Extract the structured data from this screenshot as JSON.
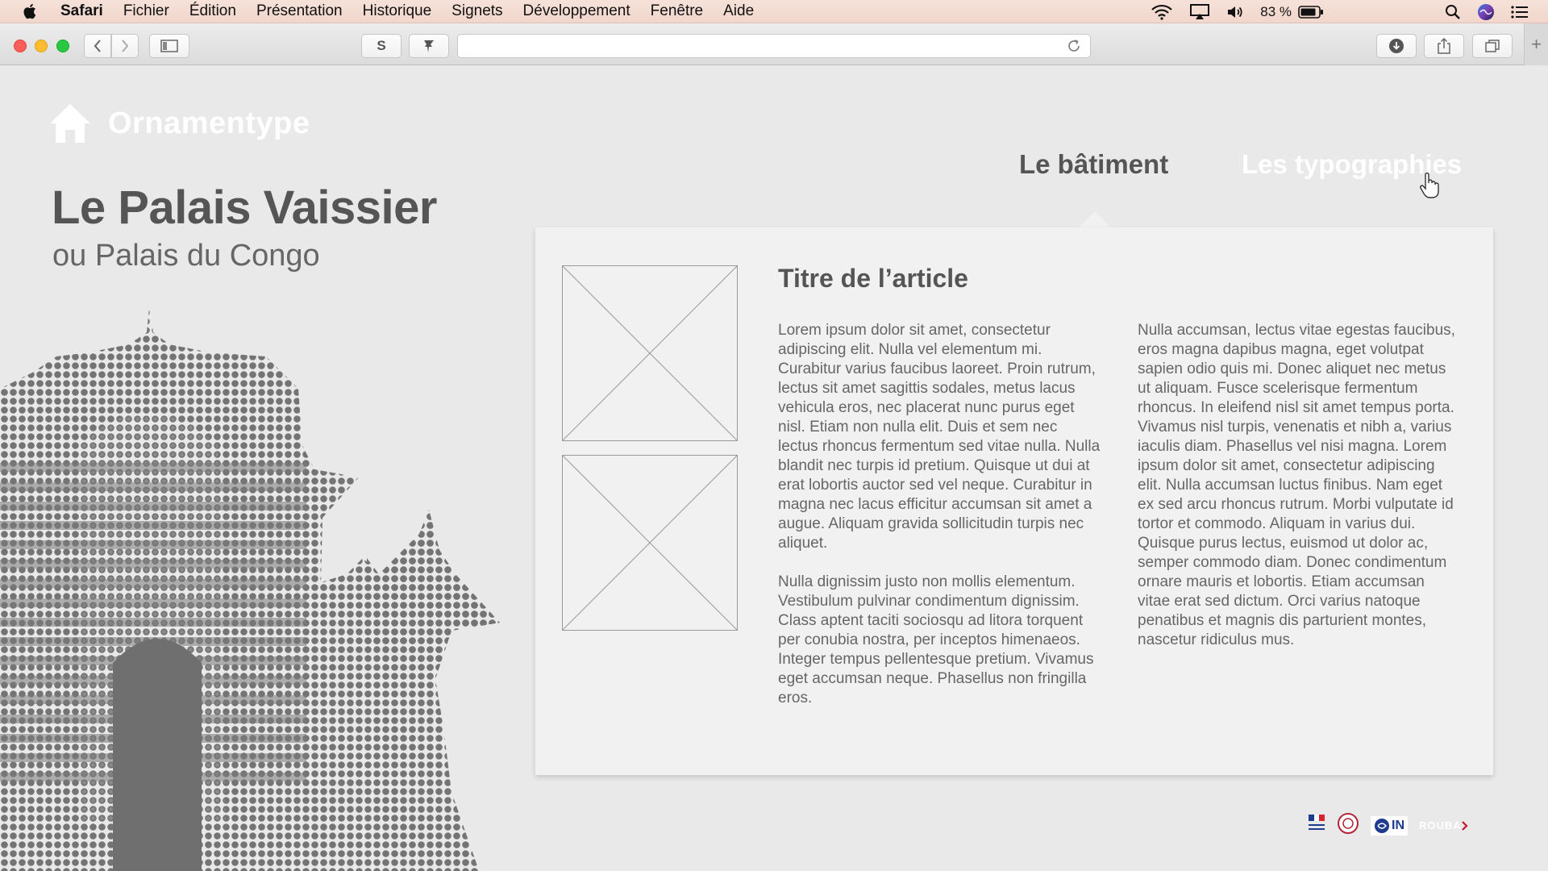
{
  "menubar": {
    "app_name": "Safari",
    "items": [
      "Fichier",
      "Édition",
      "Présentation",
      "Historique",
      "Signets",
      "Développement",
      "Fenêtre",
      "Aide"
    ],
    "battery_percent": "83 %",
    "icons": [
      "apple-icon",
      "wifi-icon",
      "airplay-icon",
      "volume-icon",
      "battery-icon",
      "spotlight-icon",
      "siri-icon",
      "notification-center-icon"
    ]
  },
  "toolbar": {
    "extension_s_label": "S",
    "new_tab_label": "+",
    "icons": [
      "back-icon",
      "forward-icon",
      "sidebar-icon",
      "pin-icon",
      "reload-icon",
      "download-icon",
      "share-icon",
      "tabs-icon"
    ]
  },
  "site": {
    "logo_text": "Ornamentype",
    "title": "Le Palais Vaissier",
    "subtitle": "ou Palais du Congo",
    "nav": [
      "Le bâtiment",
      "Les typographies"
    ]
  },
  "article": {
    "title": "Titre de l’article",
    "col1": [
      "Lorem ipsum dolor sit amet, consectetur adipiscing elit. Nulla vel elementum mi. Curabitur varius faucibus laoreet. Proin rutrum, lectus sit amet sagittis sodales, metus lacus vehicula eros, nec placerat nunc purus eget nisl. Etiam non nulla elit. Duis et sem nec lectus rhoncus fermentum sed vitae nulla. Nulla blandit nec turpis id pretium. Quisque ut dui at erat lobortis auctor sed vel neque. Curabitur in magna nec lacus efficitur accumsan sit amet a augue. Aliquam gravida sollicitudin turpis nec aliquet.",
      "Nulla dignissim justo non mollis elementum. Vestibulum pulvinar condimentum dignissim. Class aptent taciti sociosqu ad litora torquent per conubia nostra, per inceptos himenaeos. Integer tempus pellentesque pretium. Vivamus eget accumsan neque. Phasellus non fringilla eros."
    ],
    "col2": [
      "Nulla accumsan, lectus vitae egestas faucibus, eros magna dapibus magna, eget volutpat sapien odio quis mi. Donec aliquet nec metus ut aliquam. Fusce scelerisque fermentum rhoncus. In eleifend nisl sit amet tempus porta. Vivamus nisl turpis, venenatis et nibh a, varius iaculis diam. Phasellus vel nisi magna. Lorem ipsum dolor sit amet, consectetur adipiscing elit. Nulla accumsan luctus finibus. Nam eget ex sed arcu rhoncus rutrum. Morbi vulputate id tortor et commodo. Aliquam in varius dui. Quisque purus lectus, euismod ut dolor ac, semper commodo diam. Donec condimentum ornare mauris et lobortis. Etiam accumsan vitae erat sed dictum. Orci varius natoque penatibus et magnis dis parturient montes, nascetur ridiculus mus."
    ]
  },
  "footer": {
    "logo_in": "IN",
    "logo_roubaix": "ROUBA"
  },
  "colors": {
    "page_bg": "#e9e9e9",
    "card_bg": "#f1f1f1",
    "heading": "#555555",
    "body_text": "#666666",
    "building": "#7a7a7a"
  }
}
